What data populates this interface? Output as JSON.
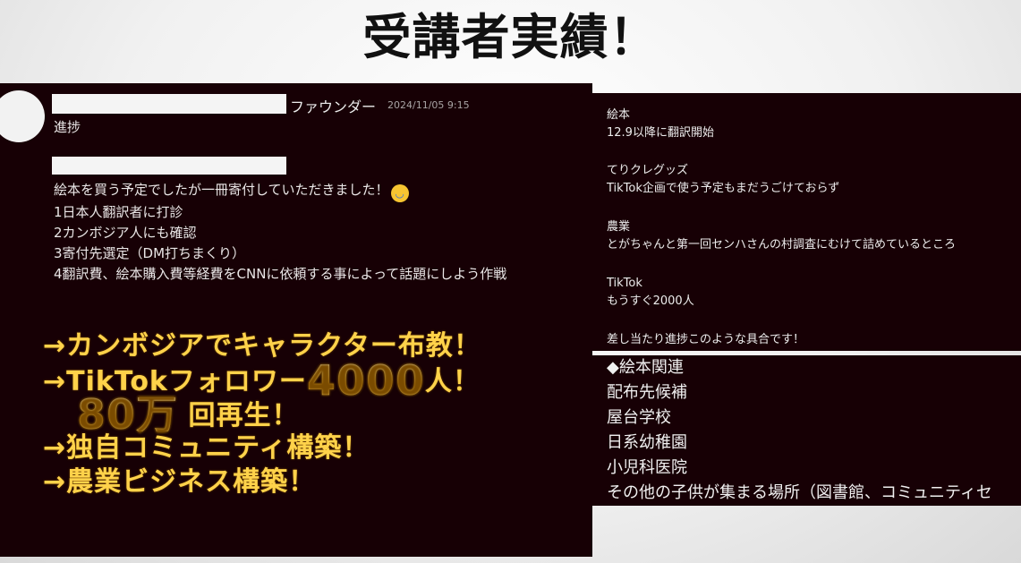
{
  "title": "受講者実績！",
  "post": {
    "role": "ファウンダー",
    "timestamp": "2024/11/05 9:15",
    "progress_label": "進捗",
    "message_lines": [
      "絵本を買う予定でしたが一冊寄付していただきました！",
      "1日本人翻訳者に打診",
      "2カンボジア人にも確認",
      "3寄付先選定（DM打ちまくり）",
      "4翻訳費、絵本購入費等経費をCNNに依頼する事によって話題にしよう作戦"
    ],
    "emoji": "😭"
  },
  "results": {
    "line1": "→カンボジアでキャラクター布教！",
    "line2_prefix": "→TikTokフォロワー",
    "line2_big": "4000",
    "line2_suffix": "人！",
    "line3_big": "80万",
    "line3_suffix": "回再生！",
    "line4": "→独自コミュニティ構築！",
    "line5": "→農業ビジネス構築！"
  },
  "updates": [
    {
      "heading": "絵本",
      "body": "12.9以降に翻訳開始"
    },
    {
      "heading": "てりクレグッズ",
      "body": "TikTok企画で使う予定もまだうごけておらず"
    },
    {
      "heading": "農業",
      "body": "とがちゃんと第一回センハさんの村調査にむけて詰めているところ"
    },
    {
      "heading": "TikTok",
      "body": "もうすぐ2000人"
    },
    {
      "heading": "",
      "body": "差し当たり進捗このような具合です！"
    }
  ],
  "distribution": {
    "header": "◆絵本関連",
    "items": [
      "配布先候補",
      "屋台学校",
      "日系幼稚園",
      "小児科医院",
      "その他の子供が集まる場所（図書館、コミュニティセ"
    ]
  }
}
